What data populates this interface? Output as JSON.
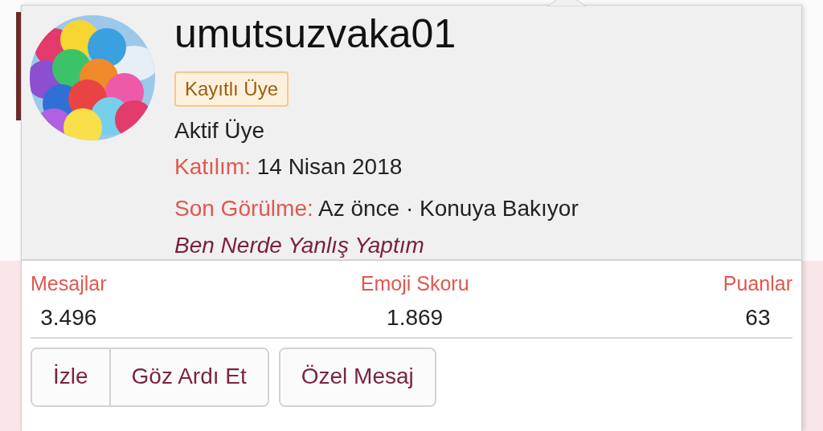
{
  "user": {
    "name": "umutsuzvaka01",
    "badge": "Kayıtlı Üye",
    "title": "Aktif Üye",
    "details": [
      {
        "label": "Katılım:",
        "value": "14 Nisan 2018"
      },
      {
        "label": "Son Görülme:",
        "value": "Az önce · Konuya Bakıyor",
        "link": "Ben Nerde Yanlış Yaptım"
      }
    ]
  },
  "stats": [
    {
      "label": "Mesajlar",
      "value": "3.496"
    },
    {
      "label": "Emoji Skoru",
      "value": "1.869"
    },
    {
      "label": "Puanlar",
      "value": "63"
    }
  ],
  "button_groups": [
    [
      "İzle",
      "Göz Ardı Et"
    ],
    [
      "Özel Mesaj"
    ]
  ]
}
